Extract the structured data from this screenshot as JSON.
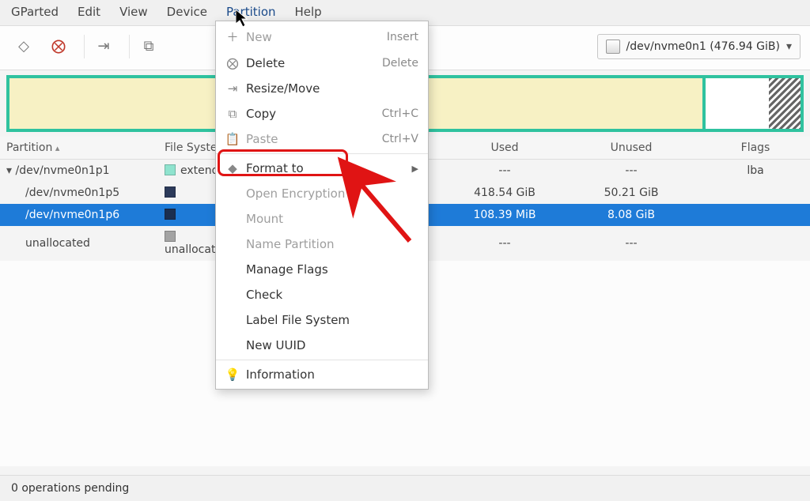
{
  "menubar": {
    "items": [
      "GParted",
      "Edit",
      "View",
      "Device",
      "Partition",
      "Help"
    ],
    "active_index": 4
  },
  "toolbar": {
    "device_selector_text": "/dev/nvme0n1 (476.94 GiB)"
  },
  "table": {
    "headers": {
      "partition": "Partition",
      "fs": "File System",
      "used": "Used",
      "unused": "Unused",
      "flags": "Flags"
    },
    "rows": [
      {
        "name": "/dev/nvme0n1p1",
        "fs": "extended",
        "used": "---",
        "unused": "---",
        "flags": "lba",
        "indent": 0,
        "swatch": "sw-ext4"
      },
      {
        "name": "/dev/nvme0n1p5",
        "fs": "",
        "used": "418.54 GiB",
        "unused": "50.21 GiB",
        "flags": "",
        "indent": 1,
        "swatch": "sw-dark"
      },
      {
        "name": "/dev/nvme0n1p6",
        "fs": "",
        "used": "108.39 MiB",
        "unused": "8.08 GiB",
        "flags": "",
        "indent": 1,
        "swatch": "sw-darknavy",
        "selected": true
      },
      {
        "name": "unallocated",
        "fs": "unallocated",
        "used": "---",
        "unused": "---",
        "flags": "",
        "indent": 1,
        "swatch": "sw-gray"
      }
    ]
  },
  "dropdown": {
    "items": [
      {
        "label": "New",
        "accel": "Insert",
        "icon": "＋",
        "disabled": true
      },
      {
        "label": "Delete",
        "accel": "Delete",
        "icon": "⨂"
      },
      {
        "label": "Resize/Move",
        "icon": "⇥"
      },
      {
        "label": "Copy",
        "accel": "Ctrl+C",
        "icon": "⧉"
      },
      {
        "label": "Paste",
        "accel": "Ctrl+V",
        "icon": "📋",
        "disabled": true
      },
      {
        "sep": true
      },
      {
        "label": "Format to",
        "icon": "◆",
        "submenu": true
      },
      {
        "label": "Open Encryption",
        "disabled": true
      },
      {
        "label": "Mount",
        "disabled": true
      },
      {
        "label": "Name Partition",
        "disabled": true
      },
      {
        "label": "Manage Flags"
      },
      {
        "label": "Check"
      },
      {
        "label": "Label File System"
      },
      {
        "label": "New UUID"
      },
      {
        "sep": true
      },
      {
        "label": "Information",
        "icon": "💡"
      }
    ]
  },
  "status": {
    "text": "0 operations pending"
  },
  "annotation": {
    "highlight_target": "Format to",
    "arrow_from": "lower-right",
    "arrow_to": "Format to menu item"
  }
}
